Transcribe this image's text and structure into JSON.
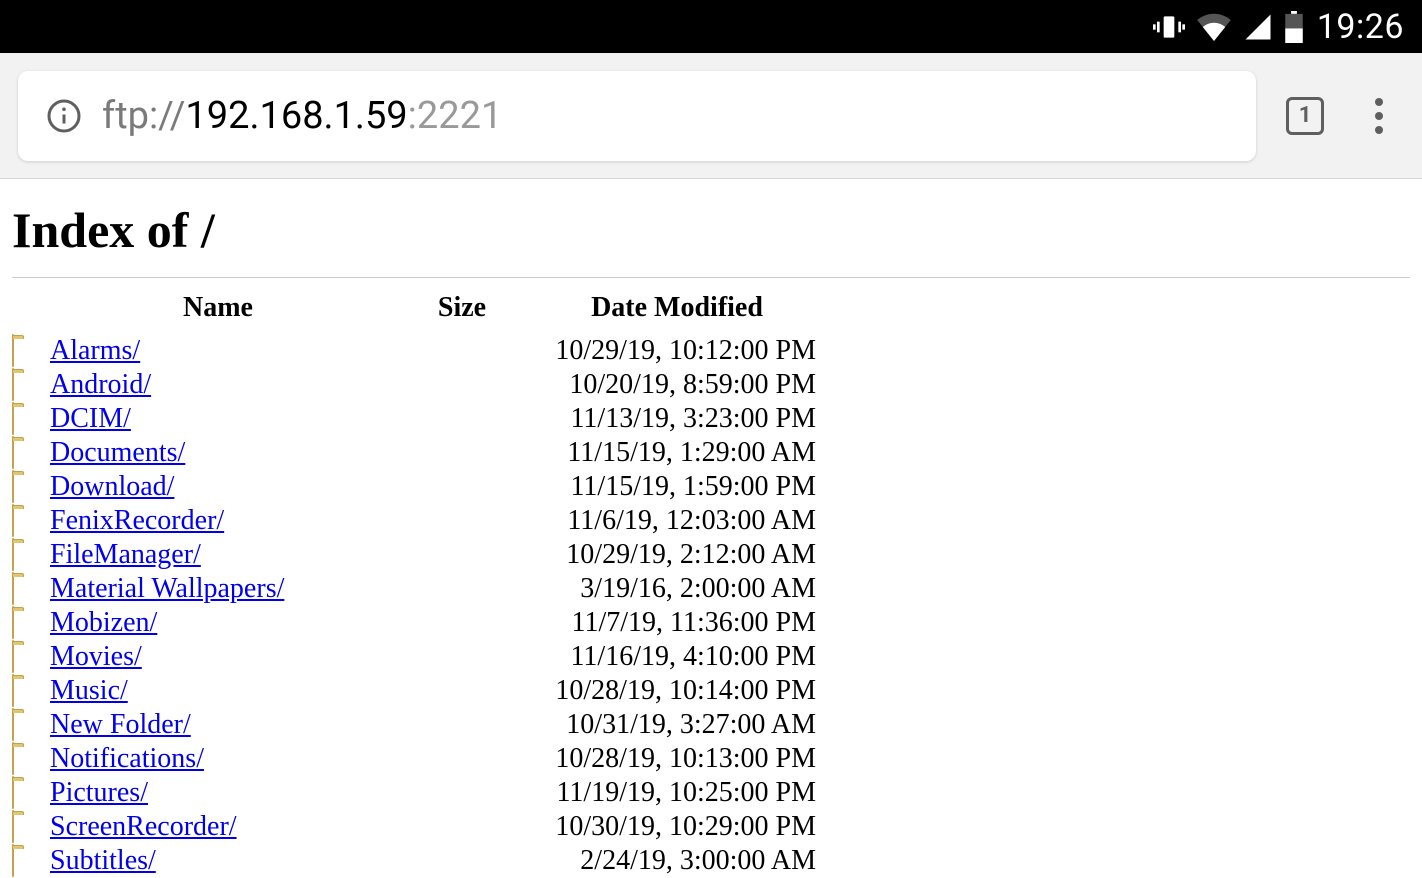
{
  "statusbar": {
    "clock": "19:26"
  },
  "toolbar": {
    "url": {
      "protocol": "ftp://",
      "host": "192.168.1.59",
      "port": ":2221"
    },
    "tab_count": "1"
  },
  "page": {
    "title": "Index of /",
    "headers": {
      "name": "Name",
      "size": "Size",
      "date": "Date Modified"
    },
    "entries": [
      {
        "name": "Alarms/",
        "size": "",
        "date": "10/29/19, 10:12:00 PM"
      },
      {
        "name": "Android/",
        "size": "",
        "date": "10/20/19, 8:59:00 PM"
      },
      {
        "name": "DCIM/",
        "size": "",
        "date": "11/13/19, 3:23:00 PM"
      },
      {
        "name": "Documents/",
        "size": "",
        "date": "11/15/19, 1:29:00 AM"
      },
      {
        "name": "Download/",
        "size": "",
        "date": "11/15/19, 1:59:00 PM"
      },
      {
        "name": "FenixRecorder/",
        "size": "",
        "date": "11/6/19, 12:03:00 AM"
      },
      {
        "name": "FileManager/",
        "size": "",
        "date": "10/29/19, 2:12:00 AM"
      },
      {
        "name": "Material Wallpapers/",
        "size": "",
        "date": "3/19/16, 2:00:00 AM"
      },
      {
        "name": "Mobizen/",
        "size": "",
        "date": "11/7/19, 11:36:00 PM"
      },
      {
        "name": "Movies/",
        "size": "",
        "date": "11/16/19, 4:10:00 PM"
      },
      {
        "name": "Music/",
        "size": "",
        "date": "10/28/19, 10:14:00 PM"
      },
      {
        "name": "New Folder/",
        "size": "",
        "date": "10/31/19, 3:27:00 AM"
      },
      {
        "name": "Notifications/",
        "size": "",
        "date": "10/28/19, 10:13:00 PM"
      },
      {
        "name": "Pictures/",
        "size": "",
        "date": "11/19/19, 10:25:00 PM"
      },
      {
        "name": "ScreenRecorder/",
        "size": "",
        "date": "10/30/19, 10:29:00 PM"
      },
      {
        "name": "Subtitles/",
        "size": "",
        "date": "2/24/19, 3:00:00 AM"
      }
    ]
  }
}
